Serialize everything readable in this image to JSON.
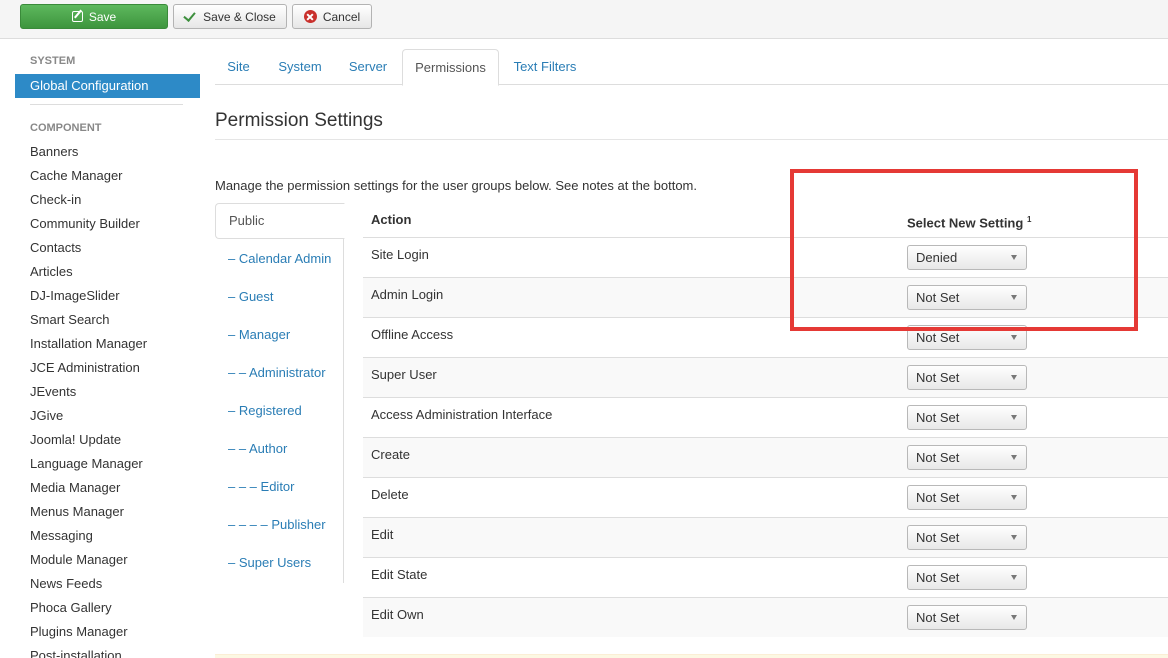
{
  "toolbar": {
    "save_label": "Save",
    "save_close_label": "Save & Close",
    "cancel_label": "Cancel"
  },
  "sidebar": {
    "system_heading": "SYSTEM",
    "active_item": "Global Configuration",
    "component_heading": "COMPONENT",
    "items": [
      "Banners",
      "Cache Manager",
      "Check-in",
      "Community Builder",
      "Contacts",
      "Articles",
      "DJ-ImageSlider",
      "Smart Search",
      "Installation Manager",
      "JCE Administration",
      "JEvents",
      "JGive",
      "Joomla! Update",
      "Language Manager",
      "Media Manager",
      "Menus Manager",
      "Messaging",
      "Module Manager",
      "News Feeds",
      "Phoca Gallery",
      "Plugins Manager",
      "Post-installation"
    ]
  },
  "tabs": [
    "Site",
    "System",
    "Server",
    "Permissions",
    "Text Filters"
  ],
  "active_tab": "Permissions",
  "page_title": "Permission Settings",
  "intro": "Manage the permission settings for the user groups below. See notes at the bottom.",
  "groups": {
    "active": "Public",
    "items": [
      "– Calendar Admin",
      "– Guest",
      "– Manager",
      "– – Administrator",
      "– Registered",
      "– – Author",
      "– – – Editor",
      "– – – – Publisher",
      "– Super Users"
    ]
  },
  "table": {
    "col_action": "Action",
    "col_setting": "Select New Setting",
    "col_setting_note": "1",
    "rows": [
      {
        "action": "Site Login",
        "setting": "Denied"
      },
      {
        "action": "Admin Login",
        "setting": "Not Set"
      },
      {
        "action": "Offline Access",
        "setting": "Not Set"
      },
      {
        "action": "Super User",
        "setting": "Not Set"
      },
      {
        "action": "Access Administration Interface",
        "setting": "Not Set"
      },
      {
        "action": "Create",
        "setting": "Not Set"
      },
      {
        "action": "Delete",
        "setting": "Not Set"
      },
      {
        "action": "Edit",
        "setting": "Not Set"
      },
      {
        "action": "Edit State",
        "setting": "Not Set"
      },
      {
        "action": "Edit Own",
        "setting": "Not Set"
      }
    ]
  },
  "colors": {
    "accent": "#2d8ac7",
    "link": "#2a7db5",
    "save_green": "#4cae4c",
    "highlight_red": "#e53935"
  }
}
